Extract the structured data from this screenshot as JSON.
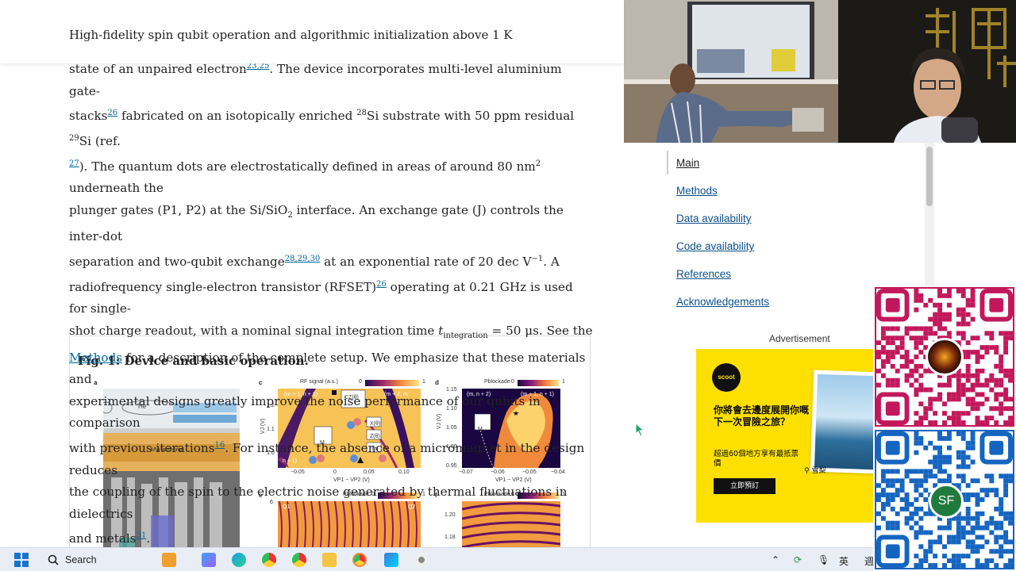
{
  "header": {
    "title": "High-fidelity spin qubit operation and algorithmic initialization above 1 K"
  },
  "article": {
    "line1_pre": "state of an unpaired electron",
    "line1_ref": "23,25",
    "line1_post": ". The device incorporates multi-level aluminium gate-",
    "line2_pre": "stacks",
    "line2_ref": "26",
    "line2_mid1": " fabricated on an isotopically enriched ",
    "line2_sup1": "28",
    "line2_mid2": "Si substrate with 50 ppm residual ",
    "line2_sup2": "29",
    "line2_post": "Si (ref.",
    "line3_ref": "27",
    "line3_pre": "). The quantum dots are electrostatically defined in areas of around 80 nm",
    "line3_sup": "2",
    "line3_post": " underneath the",
    "line4_pre": "plunger gates (P1, P2) at the Si/SiO",
    "line4_sub": "2",
    "line4_post": " interface. An exchange gate (J) controls the inter-dot",
    "line5_pre": "separation and two-qubit exchange",
    "line5_ref": "28,29,30",
    "line5_mid": " at an exponential rate of 20 dec V",
    "line5_sup": "−1",
    "line5_post": ". A",
    "line6_pre": "radiofrequency single-electron transistor (RFSET)",
    "line6_ref": "26",
    "line6_post": " operating at 0.21 GHz is used for single-",
    "line7_pre": "shot charge readout, with a nominal signal integration time ",
    "line7_t": "t",
    "line7_sub": "integration",
    "line7_post": " = 50 μs. See the",
    "line8_link": "Methods",
    "line8_post": " for a description of the complete setup. We emphasize that these materials and",
    "line9": "experimental designs greatly improve the noise performance of our qubits in comparison",
    "line10_pre": "with previous iterations",
    "line10_ref": "16",
    "line10_post": ". For instance, the absence of a micromagnet in the design reduces",
    "line11": "the coupling of the spin to the electric noise generated by thermal fluctuations in dielectrics",
    "line12_pre": "and metals",
    "line12_ref": "31",
    "line12_post": "."
  },
  "figure": {
    "title": "Fig. 1: Device and basic operation.",
    "panels": {
      "a": "a",
      "c": "c",
      "d": "d",
      "e": "e",
      "f": "f",
      "a_label_he": "He",
      "a_label_mw": "MW antenna",
      "c_colorbar": "RF signal (a.u.)",
      "c_cb_left": "0",
      "c_cb_right": "1",
      "c_region_tl": "(m + 1, n + 1)",
      "c_region_tr": "(m + 2, m",
      "c_region_bl": "n + 1)",
      "c_box_cz": "CZ(θ)",
      "c_box_x": "X(θ)",
      "c_box_z": "Z(θ)",
      "c_box_i": "I(t)",
      "c_box_m": "M",
      "c_yticks": [
        "1.2",
        "1.1",
        "1.0"
      ],
      "c_xticks": [
        "−0.05",
        "0",
        "0.05",
        "0.10"
      ],
      "c_ylabel": "VJ (V)",
      "c_xlabel": "VP1 − VP2 (V)",
      "d_colorbar": "Pblockade",
      "d_cb_left": "0",
      "d_cb_right": "1",
      "d_region_l": "(m, n + 2)",
      "d_region_r": "(m + 1, n + 1)",
      "d_box_m": "M",
      "d_yticks": [
        "1.15",
        "1.10",
        "1.05",
        "1.00",
        "0.95"
      ],
      "d_xticks": [
        "−0.07",
        "−0.06",
        "−0.05",
        "−0.04"
      ],
      "d_ylabel": "VJ (V)",
      "d_xlabel": "VP1 − VP2 (V)",
      "e_colorbar": "Pblockade",
      "e_cb_left": "0",
      "e_cb_right": "1",
      "e_q1": "Q1",
      "e_q2": "Q2",
      "e_ytick": "6",
      "f_colorbar": "Pblockade",
      "f_cb_left": "0",
      "f_cb_right": "1",
      "f_yticks": [
        "1.20",
        "1.18"
      ]
    }
  },
  "sidenav": {
    "items": [
      {
        "label": "Main"
      },
      {
        "label": "Methods"
      },
      {
        "label": "Data availability"
      },
      {
        "label": "Code availability"
      },
      {
        "label": "References"
      },
      {
        "label": "Acknowledgements"
      }
    ]
  },
  "advert": {
    "label": "Advertisement",
    "logo": "scoot",
    "headline": "你將會去邊度展開你嘅下一次冒險之旅？",
    "sub": "超過60個地方享有最抵票價",
    "cta": "立即預訂",
    "location": "雪梨"
  },
  "qr": {
    "sf_label": "SF"
  },
  "taskbar": {
    "search_label": "Search",
    "ime": "英",
    "tray_extra": "週"
  },
  "colors": {
    "link": "#006699",
    "nav_link": "#0b4f8a",
    "ad_yellow": "#fde000",
    "qr_red": "#c2185b",
    "qr_blue": "#1565c0",
    "sf_green": "#1f7a3e"
  }
}
